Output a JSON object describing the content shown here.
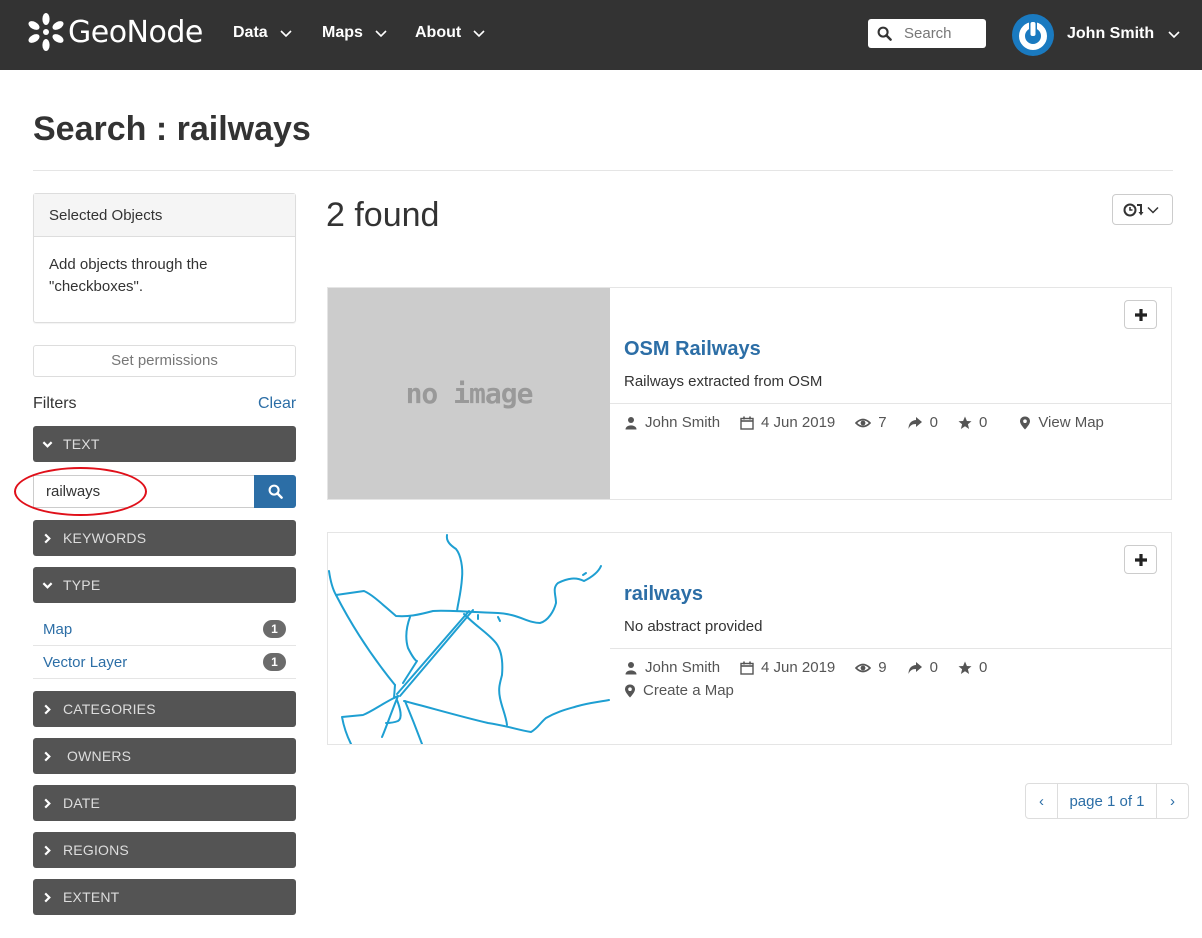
{
  "navbar": {
    "brand": "GeoNode",
    "menu": [
      {
        "label": "Data"
      },
      {
        "label": "Maps"
      },
      {
        "label": "About"
      }
    ],
    "search_placeholder": "Search",
    "user_name": "John Smith"
  },
  "page": {
    "title": "Search : railways"
  },
  "sidebar": {
    "selected_objects_title": "Selected Objects",
    "selected_objects_body": "Add objects through the \"checkboxes\".",
    "set_permissions_label": "Set permissions",
    "filters_label": "Filters",
    "clear_label": "Clear",
    "facets": {
      "text": {
        "label": "TEXT",
        "expanded": true
      },
      "keywords": {
        "label": "KEYWORDS",
        "expanded": false
      },
      "type": {
        "label": "TYPE",
        "expanded": true
      },
      "categories": {
        "label": "CATEGORIES",
        "expanded": false
      },
      "owners": {
        "label": "OWNERS",
        "expanded": false
      },
      "date": {
        "label": "DATE",
        "expanded": false
      },
      "regions": {
        "label": "REGIONS",
        "expanded": false
      },
      "extent": {
        "label": "EXTENT",
        "expanded": false
      }
    },
    "text_search_value": "railways",
    "type_items": [
      {
        "label": "Map",
        "count": "1"
      },
      {
        "label": "Vector Layer",
        "count": "1"
      }
    ]
  },
  "results": {
    "found_label": "2 found",
    "items": [
      {
        "thumbnail": "no image",
        "title": "OSM Railways",
        "abstract": "Railways extracted from OSM",
        "owner": "John Smith",
        "date": "4 Jun 2019",
        "views": "7",
        "shares": "0",
        "rating": "0",
        "action": "View Map"
      },
      {
        "thumbnail": "railway-lines-map",
        "title": "railways",
        "abstract": "No abstract provided",
        "owner": "John Smith",
        "date": "4 Jun 2019",
        "views": "9",
        "shares": "0",
        "rating": "0",
        "action": "Create a Map"
      }
    ]
  },
  "pagination": {
    "prev": "‹",
    "label": "page 1 of 1",
    "next": "›"
  },
  "colors": {
    "navbar_bg": "#333333",
    "link": "#2c6ea6",
    "facet_bg": "#545454",
    "highlight_ellipse": "#e0101a",
    "map_line": "#1e9fd2"
  }
}
